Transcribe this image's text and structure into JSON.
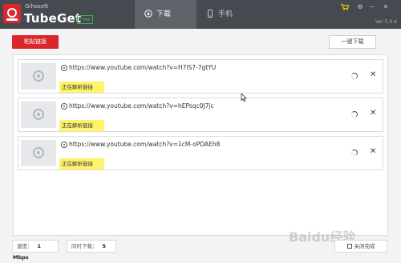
{
  "app": {
    "company": "Gihosoft",
    "name": "TubeGet",
    "edition_badge": "Free",
    "version": "Ver 5.0.4",
    "brand_color": "#d9272b",
    "titlebar_color": "#454a50"
  },
  "tabs": [
    {
      "label": "下载",
      "icon": "download-icon",
      "active": true
    },
    {
      "label": "手机",
      "icon": "phone-icon",
      "active": false
    }
  ],
  "window_controls": [
    "cart-icon",
    "gear-icon",
    "minimize-icon",
    "close-icon"
  ],
  "toolbar": {
    "paste_label": "粘贴链接",
    "onekey_label": "一键下载"
  },
  "downloads": [
    {
      "url": "https://www.youtube.com/watch?v=H7lS7-7gtYU",
      "status": "正在解析链接"
    },
    {
      "url": "https://www.youtube.com/watch?v=hEPsqc0J7jc",
      "status": "正在解析链接"
    },
    {
      "url": "https://www.youtube.com/watch?v=1cM-oPDAEh8",
      "status": "正在解析链接"
    }
  ],
  "footer": {
    "speed_label": "速度：",
    "speed_value": "1 Mbps",
    "concurrent_label": "同时下载：",
    "concurrent_value": "5",
    "close_done_label": "关闭完成"
  },
  "watermark": "Baidu经验"
}
